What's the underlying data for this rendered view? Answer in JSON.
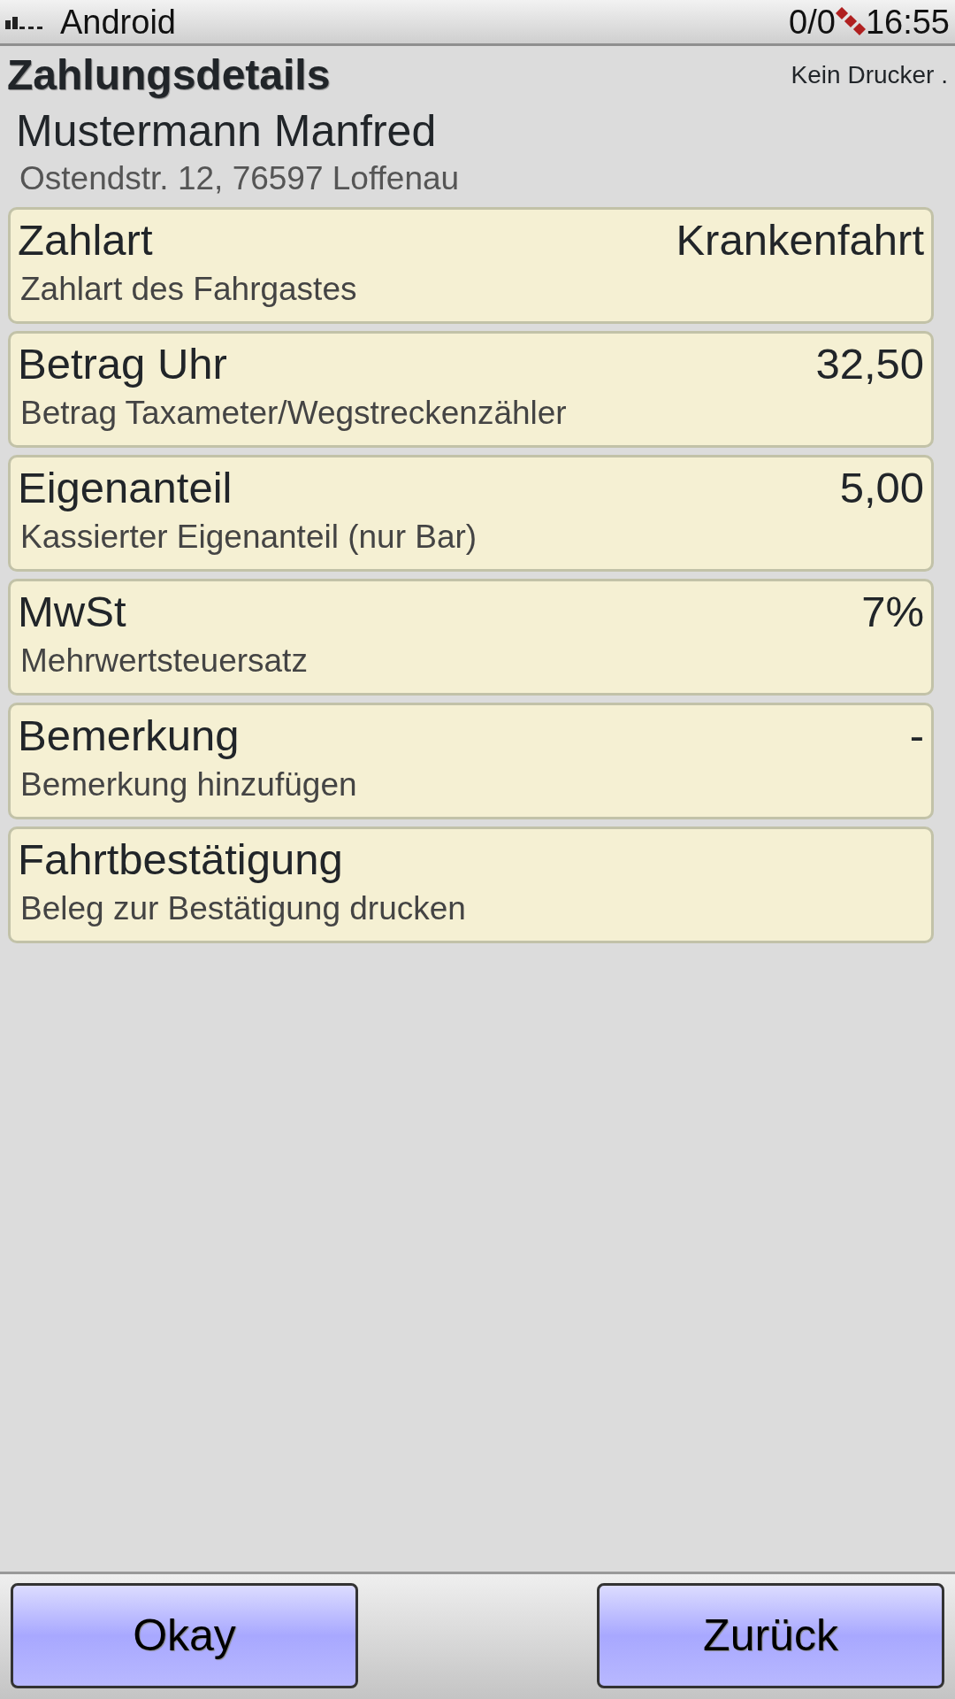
{
  "status_bar": {
    "carrier": "Android",
    "counter": "0/0",
    "time": "16:55"
  },
  "header": {
    "title": "Zahlungsdetails",
    "printer_status": "Kein Drucker ."
  },
  "customer": {
    "name": "Mustermann Manfred",
    "address": "Ostendstr. 12, 76597 Loffenau"
  },
  "items": [
    {
      "label": "Zahlart",
      "value": "Krankenfahrt",
      "description": "Zahlart des Fahrgastes"
    },
    {
      "label": "Betrag Uhr",
      "value": "32,50",
      "description": "Betrag Taxameter/Wegstreckenzähler"
    },
    {
      "label": "Eigenanteil",
      "value": "5,00",
      "description": "Kassierter Eigenanteil (nur Bar)"
    },
    {
      "label": "MwSt",
      "value": "7%",
      "description": "Mehrwertsteuersatz"
    },
    {
      "label": "Bemerkung",
      "value": "-",
      "description": "Bemerkung hinzufügen"
    },
    {
      "label": "Fahrtbestätigung",
      "description": "Beleg zur Bestätigung drucken"
    }
  ],
  "buttons": [
    "Okay",
    "Zurück"
  ]
}
